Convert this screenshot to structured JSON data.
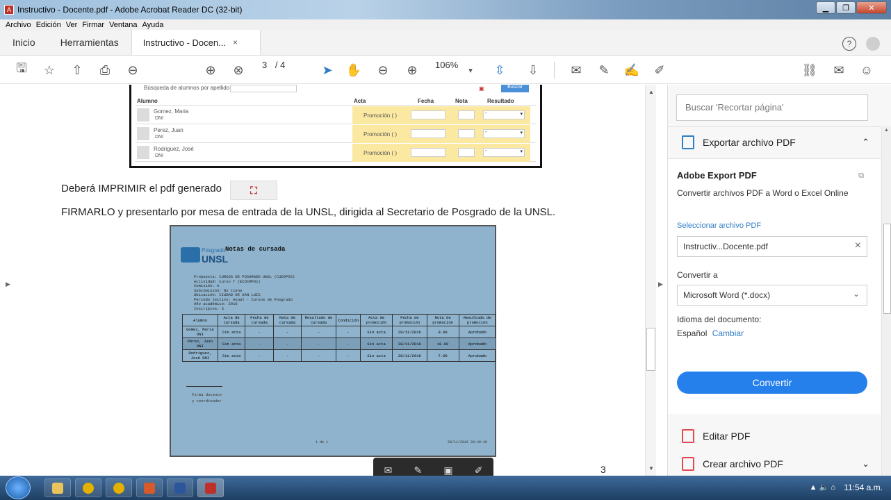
{
  "window": {
    "title": "Instructivo - Docente.pdf - Adobe Acrobat Reader DC (32-bit)"
  },
  "menu": [
    "Archivo",
    "Edición",
    "Ver",
    "Firmar",
    "Ventana",
    "Ayuda"
  ],
  "tabs": {
    "home": "Inicio",
    "tools": "Herramientas",
    "doc": "Instructivo - Docen...",
    "doc_close": "×"
  },
  "toolbar": {
    "page_current": "3",
    "page_total": "/ 4",
    "zoom": "106%"
  },
  "grade_table": {
    "search_label": "Búsqueda de alumnos por apellido",
    "search_button": "Buscar",
    "headers": {
      "alumno": "Alumno",
      "acta": "Acta",
      "fecha": "Fecha",
      "nota": "Nota",
      "resultado": "Resultado"
    },
    "rows": [
      {
        "name": "Gomez, Maria",
        "dni": "DNI",
        "acta": "Promoción ( )",
        "resultado": "-"
      },
      {
        "name": "Perez, Juan",
        "dni": "DNI",
        "acta": "Promoción ( )",
        "resultado": "-"
      },
      {
        "name": "Rodriguez, José",
        "dni": "DNI",
        "acta": "Promoción ( )",
        "resultado": "-"
      }
    ]
  },
  "doc": {
    "line1": "Deberá  IMPRIMIR el pdf generado",
    "line2": "FIRMARLO y presentarlo por mesa de entrada de la UNSL, dirigida al Secretario de Posgrado de la UNSL.",
    "page_number": "3"
  },
  "preview": {
    "logo_top": "Posgrado",
    "logo_bottom": "UNSL",
    "title": "Notas de cursada",
    "info": [
      "Propuesta: CURSOS DE POSGRADO UNSL (CUDOPOS)",
      "Actividad: Curso T (ECOCMP01)",
      "Comisión: A",
      "Subcomisión: No tiene",
      "Ubicación: CIUDAD DE SAN LUIS",
      "Período lectivo: Anual - Cursos de Posgrado",
      "Año académico: 2016",
      "Inscriptos: 3"
    ],
    "headers": [
      "Alumno",
      "Acta de cursada",
      "Fecha de cursada",
      "Nota de cursada",
      "Resultado de cursada",
      "Condición",
      "Acta de promoción",
      "Fecha de promoción",
      "Nota de promoción",
      "Resultado de promoción"
    ],
    "rows": [
      [
        "Gomez, Maria DNI",
        "Sin acta",
        "-",
        "-",
        "-",
        "-",
        "Sin acta",
        "28/11/2016",
        "8.00",
        "Aprobado"
      ],
      [
        "Perez, Juan DNI",
        "Sin acta",
        "-",
        "-",
        "-",
        "-",
        "Sin acta",
        "28/11/2016",
        "10.00",
        "Aprobado"
      ],
      [
        "Rodriguez, José DNI",
        "Sin acta",
        "-",
        "-",
        "-",
        "-",
        "Sin acta",
        "28/11/2016",
        "7.00",
        "Aprobado"
      ]
    ],
    "signature_line1": "Firma docente",
    "signature_line2": "y coordinador",
    "page_label": "1 de 1",
    "date_label": "28/11/2016 20:49:46"
  },
  "panel": {
    "search_placeholder": "Buscar 'Recortar página'",
    "export_title": "Exportar archivo PDF",
    "adobe_export": "Adobe Export PDF",
    "subtitle": "Convertir archivos PDF a Word o Excel Online",
    "select_file": "Seleccionar archivo PDF",
    "file_name": "Instructiv...Docente.pdf",
    "convert_to_label": "Convertir a",
    "convert_to_value": "Microsoft Word (*.docx)",
    "language_label": "Idioma del documento:",
    "language_value": "Español",
    "language_change": "Cambiar",
    "convert_button": "Convertir",
    "edit_pdf": "Editar PDF",
    "create_pdf": "Crear archivo PDF"
  },
  "taskbar": {
    "clock": "11:54 a.m."
  },
  "colors": {
    "accent": "#2680eb",
    "adobe_red": "#e34850",
    "highlight": "#fbe9a1"
  }
}
